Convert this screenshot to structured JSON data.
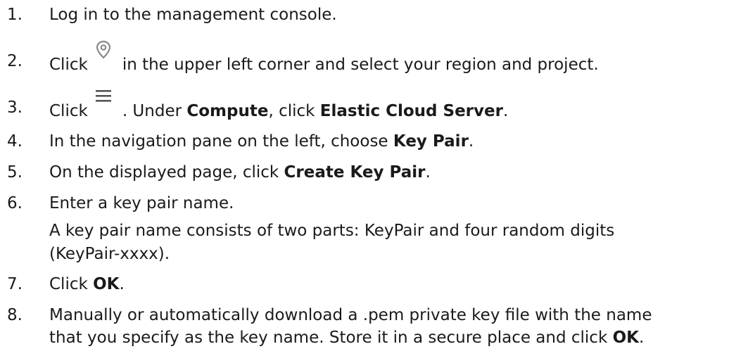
{
  "steps": [
    {
      "num": "1.",
      "pre": "Log in to the management console."
    },
    {
      "num": "2.",
      "pre": "Click",
      "icon": "location-pin-icon",
      "post": "in the upper left corner and select your region and project."
    },
    {
      "num": "3.",
      "pre": "Click",
      "icon": "hamburger-menu-icon",
      "mid1": ". Under ",
      "bold1": "Compute",
      "mid2": ", click ",
      "bold2": "Elastic Cloud Server",
      "post": "."
    },
    {
      "num": "4.",
      "pre": "In the navigation pane on the left, choose ",
      "bold1": "Key Pair",
      "post": "."
    },
    {
      "num": "5.",
      "pre": "On the displayed page, click ",
      "bold1": "Create Key Pair",
      "post": "."
    },
    {
      "num": "6.",
      "pre": "Enter a key pair name.",
      "note_line1": "A key pair name consists of two parts: KeyPair and four random digits",
      "note_line2": "(KeyPair-xxxx)."
    },
    {
      "num": "7.",
      "pre": "Click ",
      "bold1": "OK",
      "post": "."
    },
    {
      "num": "8.",
      "line1": "Manually or automatically download a .pem private key file with the name",
      "line2_pre": "that you specify as the key name. Store it in a secure place and click ",
      "bold1": "OK",
      "post": "."
    }
  ]
}
